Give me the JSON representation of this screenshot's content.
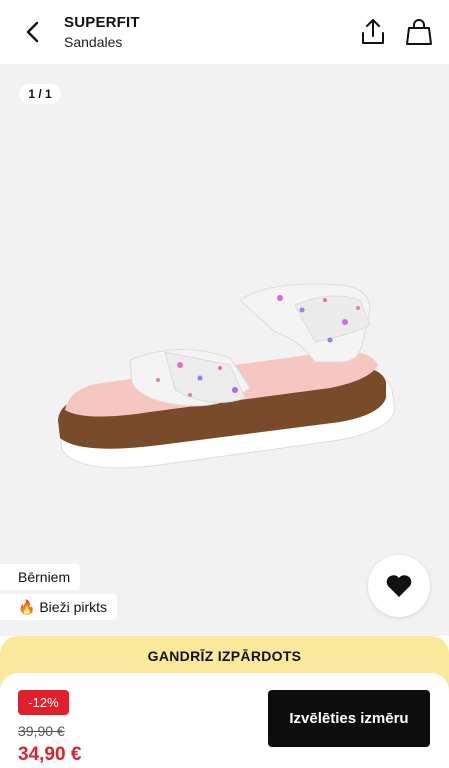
{
  "header": {
    "brand": "SUPERFIT",
    "subtitle": "Sandales"
  },
  "gallery": {
    "counter": "1 / 1"
  },
  "tags": [
    {
      "label": "Bērniem"
    },
    {
      "icon": "🔥",
      "label": "Bieži pirkts"
    }
  ],
  "banner": {
    "text": "GANDRĪZ IZPĀRDOTS"
  },
  "price": {
    "discount": "-12%",
    "old": "39,90 €",
    "current": "34,90 €"
  },
  "cta": {
    "select_size": "Izvēlēties izmēru"
  },
  "colors": {
    "sale_red": "#e0202d",
    "banner_yellow": "#fbe99b",
    "cta_black": "#0d0d0d"
  }
}
